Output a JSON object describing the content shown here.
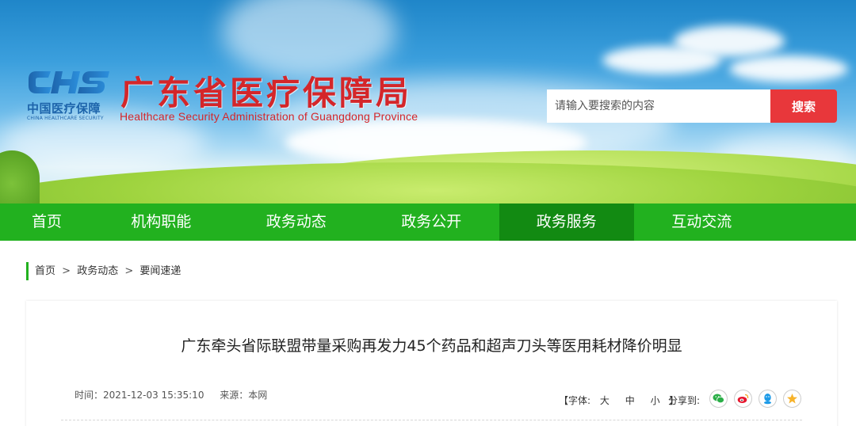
{
  "header": {
    "logo": {
      "mark": "CHS",
      "cn": "中国医疗保障",
      "en": "CHINA HEALTHCARE SECURITY"
    },
    "title": "广东省医疗保障局",
    "subtitle": "Healthcare Security Administration of Guangdong Province",
    "search": {
      "placeholder": "请输入要搜索的内容",
      "button_label": "搜索"
    }
  },
  "nav": {
    "items": [
      {
        "label": "首页"
      },
      {
        "label": "机构职能"
      },
      {
        "label": "政务动态"
      },
      {
        "label": "政务公开"
      },
      {
        "label": "政务服务",
        "active": true
      },
      {
        "label": "互动交流"
      }
    ]
  },
  "breadcrumb": {
    "items": [
      "首页",
      "政务动态",
      "要闻速递"
    ],
    "separator": ">"
  },
  "article": {
    "title": "广东牵头省际联盟带量采购再发力45个药品和超声刀头等医用耗材降价明显",
    "time": "时间：2021-12-03 15:35:10",
    "source": "来源：本网",
    "font_size": {
      "open": "【字体:",
      "large": "大",
      "medium": "中",
      "small": "小",
      "close": "】"
    },
    "share_label": "分享到:",
    "share_icons": [
      "wechat-icon",
      "weibo-icon",
      "qq-icon",
      "qzone-icon"
    ]
  },
  "colors": {
    "nav_green": "#22b11f",
    "nav_active": "#128a12",
    "title_red": "#d4262a",
    "search_red": "#e8373b",
    "logo_blue": "#1d64ab"
  }
}
